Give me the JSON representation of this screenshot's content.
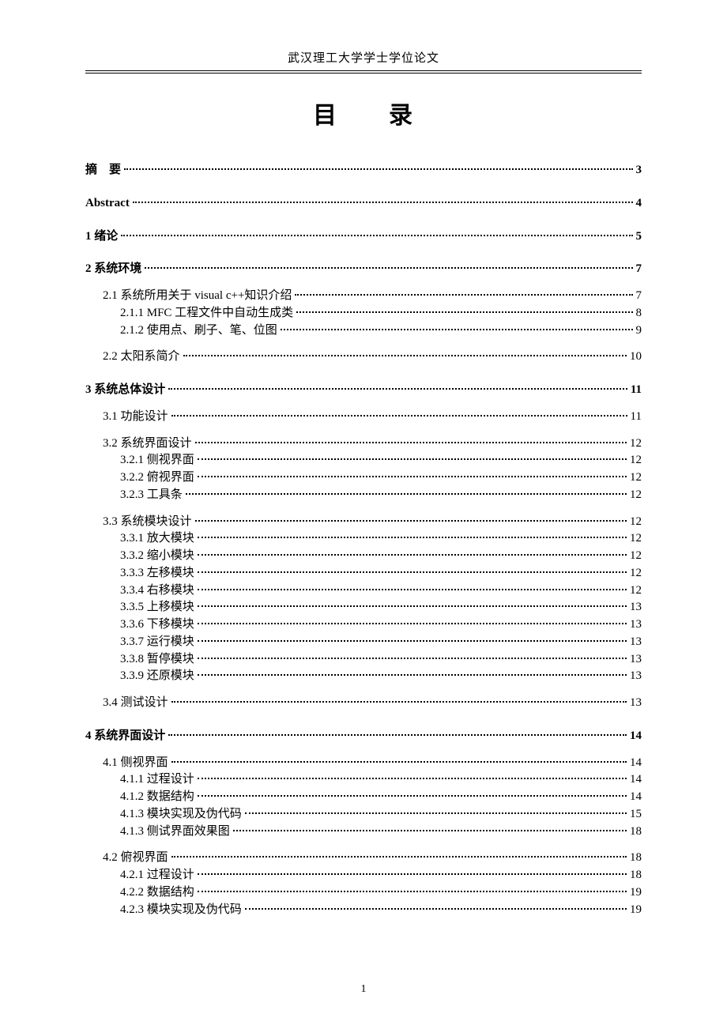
{
  "header": "武汉理工大学学士学位论文",
  "title": "目　　录",
  "page_number": "1",
  "toc": [
    {
      "type": "group",
      "items": [
        {
          "level": 1,
          "bold": true,
          "label": "摘　要",
          "page": "3"
        }
      ]
    },
    {
      "type": "group",
      "items": [
        {
          "level": 1,
          "bold": true,
          "label": "Abstract",
          "page": "4"
        }
      ]
    },
    {
      "type": "group",
      "items": [
        {
          "level": 1,
          "bold": true,
          "label": "1 绪论",
          "page": "5"
        }
      ]
    },
    {
      "type": "group",
      "items": [
        {
          "level": 1,
          "bold": true,
          "label": "2 系统环境",
          "page": "7"
        },
        {
          "level": 2,
          "bold": false,
          "label": "2.1 系统所用关于 visual c++知识介绍",
          "page": "7"
        },
        {
          "level": 3,
          "bold": false,
          "label": "2.1.1 MFC 工程文件中自动生成类",
          "page": "8"
        },
        {
          "level": 3,
          "bold": false,
          "label": "2.1.2 使用点、刷子、笔、位图",
          "page": "9"
        },
        {
          "type": "gap"
        },
        {
          "level": 2,
          "bold": false,
          "label": "2.2 太阳系简介",
          "page": "10"
        }
      ]
    },
    {
      "type": "group",
      "items": [
        {
          "level": 1,
          "bold": true,
          "label": "3 系统总体设计",
          "page": "11"
        },
        {
          "level": 2,
          "bold": false,
          "label": "3.1 功能设计",
          "page": "11"
        },
        {
          "type": "gap"
        },
        {
          "level": 2,
          "bold": false,
          "label": "3.2 系统界面设计",
          "page": "12"
        },
        {
          "level": 3,
          "bold": false,
          "label": "3.2.1 侧视界面",
          "page": "12"
        },
        {
          "level": 3,
          "bold": false,
          "label": "3.2.2 俯视界面",
          "page": "12"
        },
        {
          "level": 3,
          "bold": false,
          "label": "3.2.3 工具条",
          "page": "12"
        },
        {
          "type": "gap"
        },
        {
          "level": 2,
          "bold": false,
          "label": "3.3 系统模块设计",
          "page": "12"
        },
        {
          "level": 3,
          "bold": false,
          "label": "3.3.1 放大模块",
          "page": "12"
        },
        {
          "level": 3,
          "bold": false,
          "label": "3.3.2 缩小模块",
          "page": "12"
        },
        {
          "level": 3,
          "bold": false,
          "label": "3.3.3 左移模块",
          "page": "12"
        },
        {
          "level": 3,
          "bold": false,
          "label": "3.3.4 右移模块",
          "page": "12"
        },
        {
          "level": 3,
          "bold": false,
          "label": "3.3.5 上移模块",
          "page": "13"
        },
        {
          "level": 3,
          "bold": false,
          "label": "3.3.6 下移模块",
          "page": "13"
        },
        {
          "level": 3,
          "bold": false,
          "label": "3.3.7 运行模块",
          "page": "13"
        },
        {
          "level": 3,
          "bold": false,
          "label": "3.3.8 暂停模块",
          "page": "13"
        },
        {
          "level": 3,
          "bold": false,
          "label": "3.3.9 还原模块",
          "page": "13"
        },
        {
          "type": "gap"
        },
        {
          "level": 2,
          "bold": false,
          "label": "3.4 测试设计",
          "page": "13"
        }
      ]
    },
    {
      "type": "group",
      "items": [
        {
          "level": 1,
          "bold": true,
          "label": "4 系统界面设计",
          "page": "14"
        },
        {
          "level": 2,
          "bold": false,
          "label": "4.1 侧视界面",
          "page": "14"
        },
        {
          "level": 3,
          "bold": false,
          "label": "4.1.1 过程设计",
          "page": "14"
        },
        {
          "level": 3,
          "bold": false,
          "label": "4.1.2 数据结构",
          "page": "14"
        },
        {
          "level": 3,
          "bold": false,
          "label": "4.1.3 模块实现及伪代码",
          "page": "15"
        },
        {
          "level": 3,
          "bold": false,
          "label": "4.1.3 侧试界面效果图",
          "page": "18"
        },
        {
          "type": "gap"
        },
        {
          "level": 2,
          "bold": false,
          "label": "4.2 俯视界面",
          "page": "18"
        },
        {
          "level": 3,
          "bold": false,
          "label": "4.2.1 过程设计",
          "page": "18"
        },
        {
          "level": 3,
          "bold": false,
          "label": "4.2.2 数据结构",
          "page": "19"
        },
        {
          "level": 3,
          "bold": false,
          "label": "4.2.3 模块实现及伪代码",
          "page": "19"
        }
      ]
    }
  ]
}
